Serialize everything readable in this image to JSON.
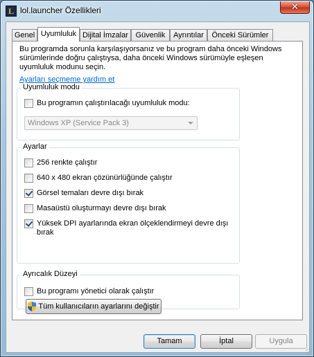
{
  "window": {
    "title": "lol.launcher Özellikleri",
    "app_icon_letter": "L",
    "close_glyph": "✕"
  },
  "tabs": [
    {
      "label": "Genel"
    },
    {
      "label": "Uyumluluk"
    },
    {
      "label": "Dijital İmzalar"
    },
    {
      "label": "Güvenlik"
    },
    {
      "label": "Ayrıntılar"
    },
    {
      "label": "Önceki Sürümler"
    }
  ],
  "active_tab": "Uyumluluk",
  "compatibility": {
    "intro": "Bu programda sorunla karşılaşıyorsanız ve bu program daha önceki Windows sürümlerinde doğru çalıştıysa, daha önceki Windows sürümüyle eşleşen uyumluluk modunu seçin.",
    "help_link": "Ayarları seçmeme yardım et",
    "mode_group": {
      "title": "Uyumluluk modu",
      "checkbox_label": "Bu programın çalıştırılacağı uyumluluk modu:",
      "checked": false,
      "select_value": "Windows XP (Service Pack 3)",
      "select_enabled": false
    },
    "settings_group": {
      "title": "Ayarlar",
      "items": [
        {
          "label": "256 renkte çalıştır",
          "checked": false
        },
        {
          "label": "640 x 480 ekran çözünürlüğünde çalıştır",
          "checked": false
        },
        {
          "label": "Görsel temaları devre dışı bırak",
          "checked": true
        },
        {
          "label": "Masaüstü oluşturmayı devre dışı bırak",
          "checked": false
        },
        {
          "label": "Yüksek DPI ayarlarında ekran ölçeklendirmeyi devre dışı bırak",
          "checked": true
        }
      ]
    },
    "privilege_group": {
      "title": "Ayrıcalık Düzeyi",
      "checkbox_label": "Bu programı yönetici olarak çalıştır",
      "checked": false
    },
    "all_users_button": "Tüm kullanıcıların ayarlarını değiştir"
  },
  "buttons": {
    "ok": "Tamam",
    "cancel": "İptal",
    "apply": "Uygula"
  },
  "colors": {
    "link": "#0066cc",
    "default_button_border": "#3c7fb1"
  }
}
